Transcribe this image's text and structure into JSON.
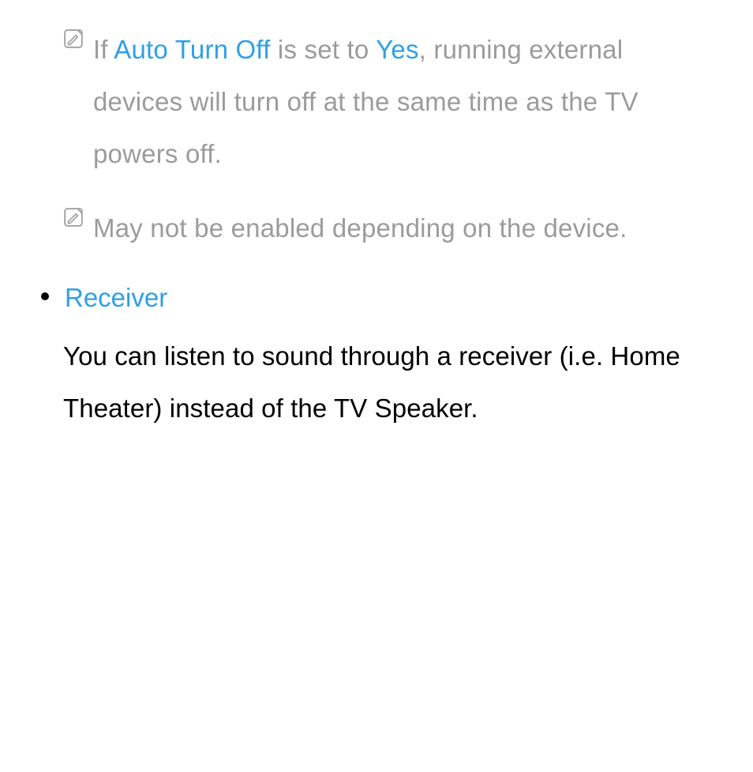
{
  "notes": [
    {
      "segments": [
        {
          "text": "If ",
          "hl": false
        },
        {
          "text": "Auto Turn Off",
          "hl": true
        },
        {
          "text": " is set to ",
          "hl": false
        },
        {
          "text": "Yes",
          "hl": true
        },
        {
          "text": ", running external devices will turn off at the same time as the TV powers off.",
          "hl": false
        }
      ]
    },
    {
      "segments": [
        {
          "text": "May not be enabled depending on the device.",
          "hl": false
        }
      ]
    }
  ],
  "section": {
    "title": "Receiver",
    "body": "You can listen to sound through a receiver (i.e. Home Theater) instead of the TV Speaker."
  }
}
